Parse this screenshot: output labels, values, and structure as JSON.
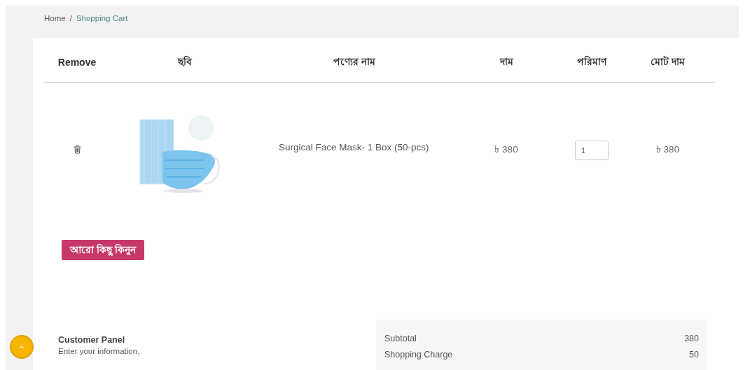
{
  "breadcrumb": [
    {
      "label": "Home",
      "current": false
    },
    {
      "label": "Shopping Cart",
      "current": true
    }
  ],
  "breadcrumb_separator": "/",
  "cart": {
    "columns": [
      "Remove",
      "ছবি",
      "পণ্যের নাম",
      "দাম",
      "পরিমাণ",
      "মোট দাম"
    ],
    "rows": [
      {
        "name": "Surgical Face Mask- 1 Box (50-pcs)",
        "price": "৳ 380",
        "quantity": "1",
        "total": "৳ 380"
      }
    ]
  },
  "continue_button": "আরো কিছু কিনুন",
  "customer_panel": {
    "title": "Customer Panel",
    "subtitle": "Enter your information."
  },
  "summary": [
    {
      "label": "Subtotal",
      "value": "380"
    },
    {
      "label": "Shopping Charge",
      "value": "50"
    }
  ]
}
